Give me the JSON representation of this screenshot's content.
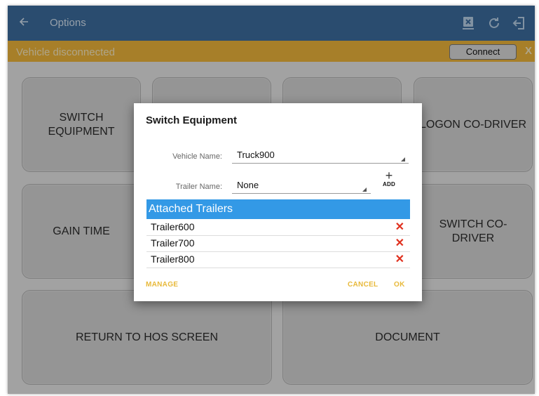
{
  "app_bar": {
    "title": "Options",
    "back_icon": "arrow-back-icon",
    "icons": [
      "device-disconnect-icon",
      "refresh-icon",
      "logout-icon"
    ],
    "color": "#3d6d9f"
  },
  "banner": {
    "message": "Vehicle disconnected",
    "connect_label": "Connect",
    "close_label": "X",
    "color": "#f0b63c"
  },
  "tiles": {
    "switch_equipment": "SWITCH\nEQUIPMENT",
    "logon_co_driver": "LOGON CO-DRIVER",
    "gain_time": "GAIN TIME",
    "switch_co_driver": "SWITCH CO-\nDRIVER",
    "return_to_hos": "RETURN TO HOS SCREEN",
    "document": "DOCUMENT"
  },
  "dialog": {
    "title": "Switch Equipment",
    "vehicle_label": "Vehicle Name:",
    "vehicle_value": "Truck900",
    "trailer_label": "Trailer Name:",
    "trailer_value": "None",
    "add_label": "ADD",
    "attached_header": "Attached Trailers",
    "attached_trailers": [
      "Trailer600",
      "Trailer700",
      "Trailer800"
    ],
    "manage_label": "MANAGE",
    "cancel_label": "CANCEL",
    "ok_label": "OK",
    "accent": "#3399e6",
    "action_color": "#e8b93a",
    "remove_color": "#e0301e"
  }
}
